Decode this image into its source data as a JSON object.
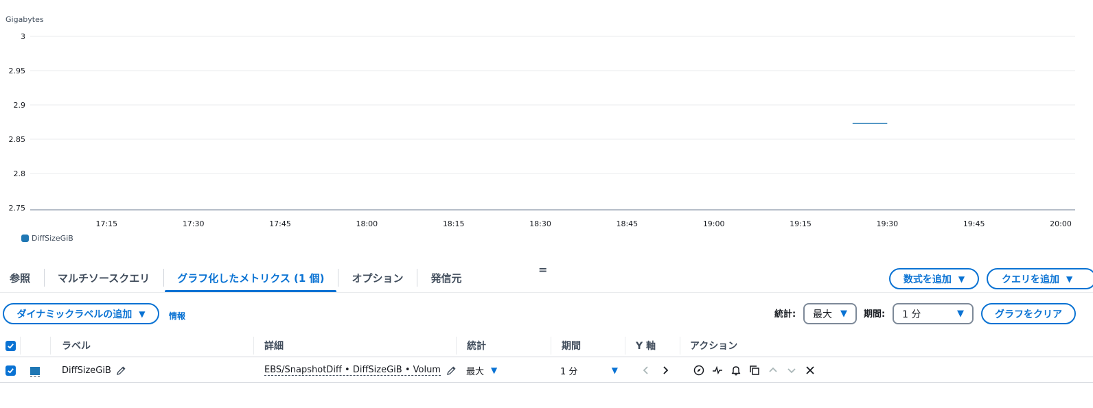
{
  "chart_data": {
    "type": "line",
    "ylabel": "Gigabytes",
    "ylim": [
      2.75,
      3
    ],
    "y_ticks": [
      "3",
      "2.95",
      "2.9",
      "2.85",
      "2.8",
      "2.75"
    ],
    "x_ticks": [
      "17:15",
      "17:30",
      "17:45",
      "18:00",
      "18:15",
      "18:30",
      "18:45",
      "19:00",
      "19:15",
      "19:30",
      "19:45",
      "20:00"
    ],
    "series": [
      {
        "name": "DiffSizeGiB",
        "color": "#1f77b4",
        "points": [
          {
            "x": "19:24",
            "y": 2.873
          },
          {
            "x": "19:30",
            "y": 2.873
          }
        ]
      }
    ],
    "grid": true,
    "legend": "bottom-left"
  },
  "tabs": [
    {
      "label": "参照",
      "active": false
    },
    {
      "label": "マルチソースクエリ",
      "active": false
    },
    {
      "label": "グラフ化したメトリクス (1 個)",
      "active": true
    },
    {
      "label": "オプション",
      "active": false
    },
    {
      "label": "発信元",
      "active": false
    }
  ],
  "drag_handle": "=",
  "buttons": {
    "add_math": "数式を追加",
    "add_query": "クエリを追加",
    "dynamic_label": "ダイナミックラベルの追加",
    "info": "情報",
    "clear_graph": "グラフをクリア"
  },
  "controls": {
    "stat_label": "統計:",
    "stat_value": "最大",
    "period_label": "期間:",
    "period_value": "1 分"
  },
  "table": {
    "headers": {
      "label": "ラベル",
      "details": "詳細",
      "stat": "統計",
      "period": "期間",
      "y_axis": "Y 軸",
      "actions": "アクション"
    },
    "rows": [
      {
        "label": "DiffSizeGiB",
        "details": "EBS/SnapshotDiff • DiffSizeGiB • VolumeId",
        "stat": "最大",
        "period": "1 分",
        "color": "#1f77b4"
      }
    ]
  },
  "colors": {
    "accent": "#0972d3",
    "series": "#1f77b4"
  }
}
